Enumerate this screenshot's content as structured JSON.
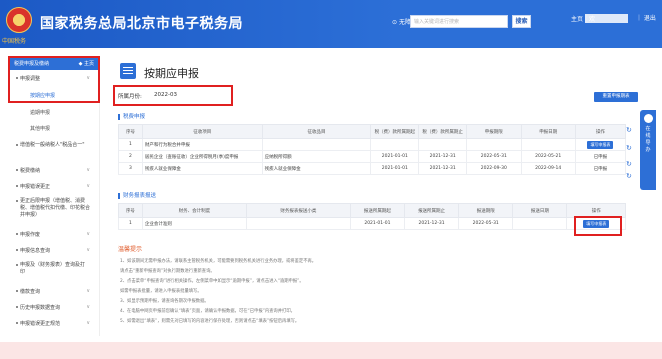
{
  "header": {
    "emblem_text": "中国税务",
    "title": "国家税务总局北京市电子税务局",
    "barrier_free": "无障碍阅读",
    "search_placeholder": "输入关键词进行搜索",
    "search_button": "搜索",
    "user_prefix": "主页｜欢",
    "logout": "｜ 退出"
  },
  "sidebar": {
    "head": "税费申报及缴纳",
    "head_badge": "◆ 主页",
    "items": [
      {
        "label": "申报调整",
        "chev": "∨"
      },
      {
        "label": "按期应申报"
      },
      {
        "label": "逾期申报"
      },
      {
        "label": "其他申报"
      },
      {
        "label": "增值税一般纳税人\"税品合一\""
      },
      {
        "label": "税费缴纳",
        "chev": "∨"
      },
      {
        "label": "申报错误更正",
        "chev": "∨"
      },
      {
        "label": "更正后限申报（增值税、消费税、增值税代扣代缴、印花税合并申报）"
      },
      {
        "label": "申报作废",
        "chev": "∨"
      },
      {
        "label": "申报信息查询",
        "chev": "∨"
      },
      {
        "label": "申报及（财务报表）查询及打印",
        "chev": "∨"
      },
      {
        "label": "缴款查询",
        "chev": "∨"
      },
      {
        "label": "历史申报数据查询",
        "chev": "∨"
      },
      {
        "label": "申报错误更正规范",
        "chev": "∨"
      }
    ]
  },
  "main": {
    "title": "按期应申报",
    "period_label": "所属月份:",
    "period_value": "2022-03",
    "reset_button": "重置申报期表",
    "tax_section": "税费申报",
    "tax_headers": [
      "序号",
      "征收项目",
      "征收品目",
      "税（费）款所属期起",
      "税（费）款所属期止",
      "申报期限",
      "申报日期",
      "操作"
    ],
    "tax_rows": [
      [
        "1",
        "财产和行为税合并申报",
        "",
        "",
        "",
        "",
        "",
        "填写申报表"
      ],
      [
        "2",
        "居民企业（查账征收）企业所得税月(季)度申报",
        "应纳税所得额",
        "2021-01-01",
        "2021-12-31",
        "2022-05-31",
        "2022-05-21",
        "已申报"
      ],
      [
        "3",
        "残疾人就业保障金",
        "残疾人就业保障金",
        "2021-01-01",
        "2021-12-31",
        "2022-09-30",
        "2022-09-14",
        "已申报"
      ]
    ],
    "fin_section": "财务报表报送",
    "fin_headers": [
      "序号",
      "财务、会计制度",
      "财务报表报送小类",
      "报送所属期起",
      "报送所属期止",
      "报送期限",
      "报送日期",
      "操作"
    ],
    "fin_rows": [
      [
        "1",
        "企业会计准则",
        "",
        "2021-01-01",
        "2021-12-31",
        "2022-05-31",
        "",
        "填写申报表"
      ]
    ],
    "hint_title": "温馨提示",
    "hints": [
      "1、如该期间无需申报办法，请联系主管税务机关，可能需要到税务机关进行业务办理，或将鉴定不再。",
      "   请点击“重新申报查询”对执行期数进行重新查询。",
      "2、点击菜单“申报查询”进行相关操作。左侧菜单中如显示“逾期申报”，请点击进入“逾期申报”。",
      "   如需申报表批量，请进入申报表批量填写。",
      "3、如显示预期申报，请查询各期次申报数据。",
      "4、在电脑中网页申报前您确认“填表”页面，请确认申报数据，可在“已申报”内查询并打印。",
      "5、如需退出“填表”，则需先对已填写的内容进行保存处理，否则请点击“填表”按钮后再填写。"
    ]
  },
  "float_tab": "在线导办",
  "colors": {
    "brand": "#2d6fd6",
    "highlight": "#e02020"
  }
}
